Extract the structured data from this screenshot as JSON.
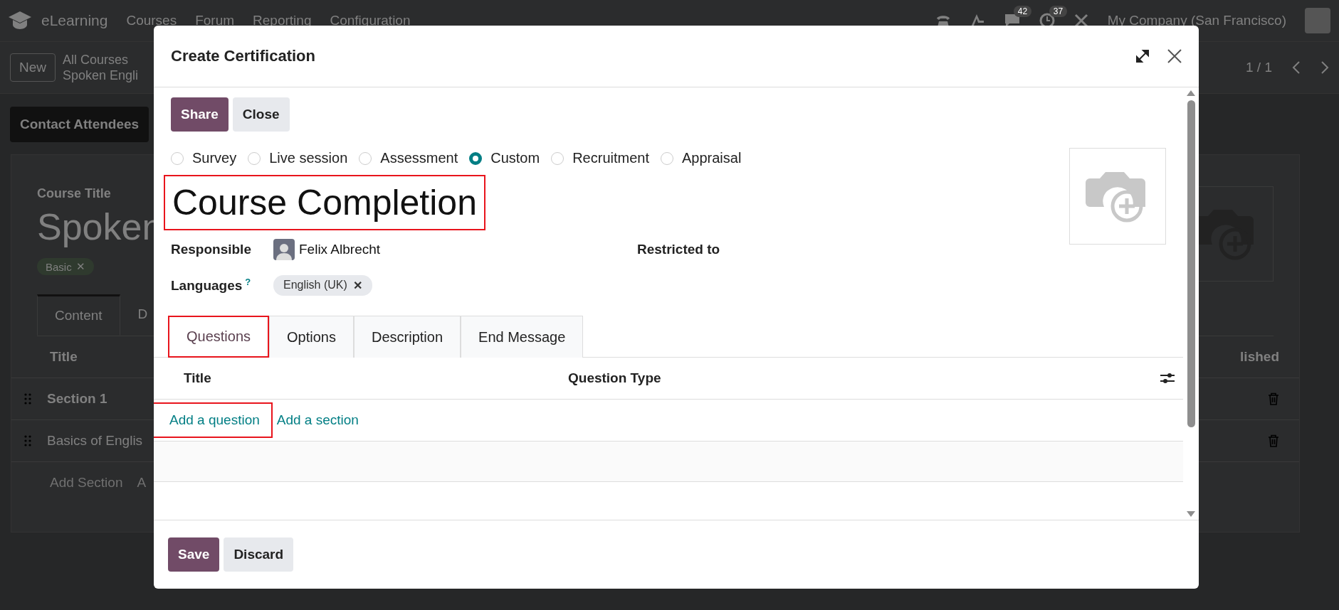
{
  "navbar": {
    "app_name": "eLearning",
    "menu": [
      "Courses",
      "Forum",
      "Reporting",
      "Configuration"
    ],
    "chat_badge": "42",
    "activity_badge": "37",
    "company": "My Company (San Francisco)"
  },
  "control_panel": {
    "new_button": "New",
    "breadcrumb": [
      "All Courses",
      "Spoken Engli"
    ],
    "pager": "1 / 1"
  },
  "action_button": "Contact Attendees",
  "course": {
    "title_label": "Course Title",
    "title": "Spoken",
    "tags": [
      {
        "label": "Basic",
        "remove": "✕"
      }
    ],
    "tabs": [
      {
        "label": "Content",
        "selected": true
      },
      {
        "label": "D",
        "selected": false
      }
    ],
    "columns": [
      "Title",
      "lished"
    ],
    "rows": [
      {
        "title": "Section 1",
        "kind": "section"
      },
      {
        "title": "Basics of Englis",
        "kind": "lesson"
      }
    ],
    "add_links": [
      "Add Section",
      "A"
    ]
  },
  "dialog": {
    "title": "Create Certification",
    "buttons": [
      {
        "label": "Share",
        "kind": "primary"
      },
      {
        "label": "Close",
        "kind": "secondary"
      }
    ],
    "certification_types": [
      {
        "label": "Survey",
        "selected": false
      },
      {
        "label": "Live session",
        "selected": false
      },
      {
        "label": "Assessment",
        "selected": false
      },
      {
        "label": "Custom",
        "selected": true
      },
      {
        "label": "Recruitment",
        "selected": false
      },
      {
        "label": "Appraisal",
        "selected": false
      }
    ],
    "name": "Course Completion",
    "name_highlighted": true,
    "responsible_label": "Responsible",
    "responsible": "Felix Albrecht",
    "restricted_label": "Restricted to",
    "languages_label": "Languages",
    "languages_help": "?",
    "languages": [
      {
        "label": "English (UK)",
        "remove": "✕"
      }
    ],
    "tabs": [
      {
        "label": "Questions",
        "selected": true,
        "highlighted": true
      },
      {
        "label": "Options",
        "selected": false,
        "highlighted": false
      },
      {
        "label": "Description",
        "selected": false,
        "highlighted": false
      },
      {
        "label": "End Message",
        "selected": false,
        "highlighted": false
      }
    ],
    "columns": [
      "Title",
      "Question Type"
    ],
    "add_links": [
      {
        "label": "Add a question",
        "highlighted": true
      },
      {
        "label": "Add a section",
        "highlighted": false
      }
    ],
    "footer_buttons": [
      {
        "label": "Save",
        "kind": "primary"
      },
      {
        "label": "Discard",
        "kind": "secondary"
      }
    ]
  }
}
